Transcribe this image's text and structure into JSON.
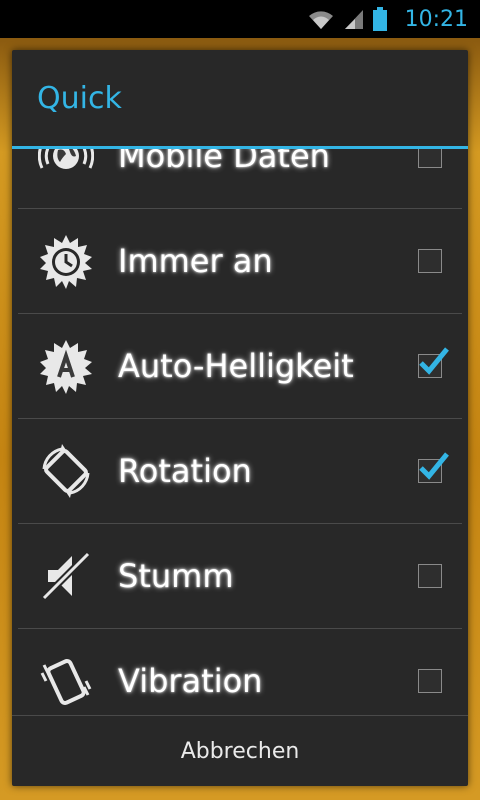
{
  "status_bar": {
    "time": "10:21",
    "icons": [
      "wifi-icon",
      "signal-icon",
      "battery-icon"
    ],
    "accent_color": "#33b5e5"
  },
  "dialog": {
    "title": "Quick",
    "accent_color": "#33b5e5",
    "items": [
      {
        "label": "Mobile Daten",
        "icon": "globe-icon",
        "checked": false
      },
      {
        "label": "Immer an",
        "icon": "clock-sun-icon",
        "checked": false
      },
      {
        "label": "Auto-Helligkeit",
        "icon": "auto-brightness-icon",
        "checked": true
      },
      {
        "label": "Rotation",
        "icon": "rotation-icon",
        "checked": true
      },
      {
        "label": "Stumm",
        "icon": "mute-icon",
        "checked": false
      },
      {
        "label": "Vibration",
        "icon": "vibrate-icon",
        "checked": false
      }
    ],
    "cancel_label": "Abbrechen"
  }
}
